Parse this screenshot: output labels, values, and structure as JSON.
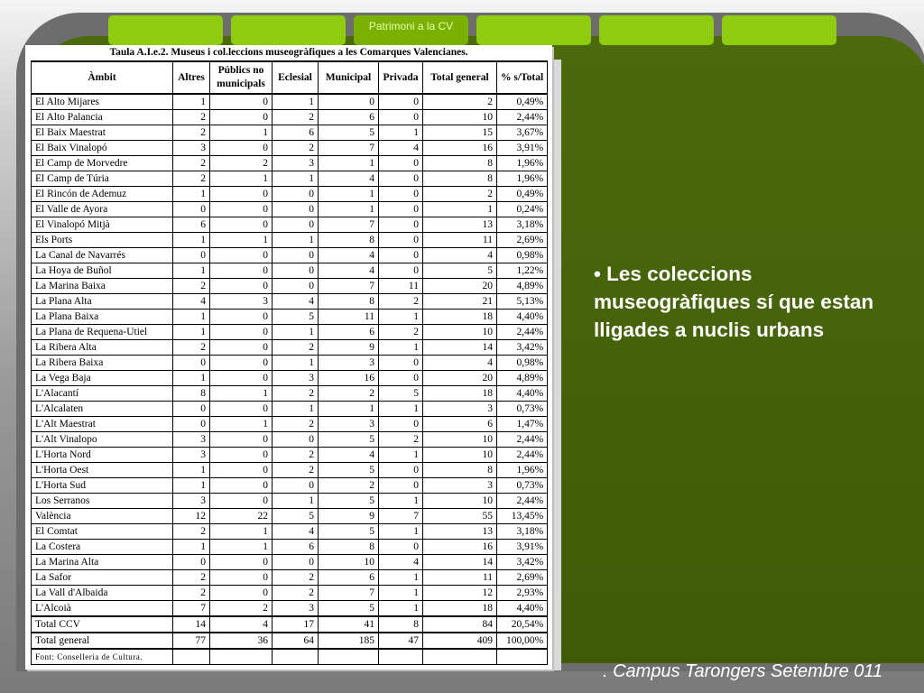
{
  "tabs": [
    {
      "label": ""
    },
    {
      "label": ""
    },
    {
      "label": "Patrimoni a la CV"
    },
    {
      "label": ""
    },
    {
      "label": ""
    },
    {
      "label": ""
    }
  ],
  "table": {
    "title": "Taula A.I.e.2. Museus i col.leccions museogràfiques a les Comarques Valencianes.",
    "headers": [
      "Àmbit",
      "Altres",
      "Públics no municipals",
      "Eclesial",
      "Municipal",
      "Privada",
      "Total general",
      "% s/Total"
    ],
    "rows": [
      [
        "El Alto Mijares",
        "1",
        "0",
        "1",
        "0",
        "0",
        "2",
        "0,49%"
      ],
      [
        "El Alto Palancia",
        "2",
        "0",
        "2",
        "6",
        "0",
        "10",
        "2,44%"
      ],
      [
        "El Baix Maestrat",
        "2",
        "1",
        "6",
        "5",
        "1",
        "15",
        "3,67%"
      ],
      [
        "El Baix Vinalopó",
        "3",
        "0",
        "2",
        "7",
        "4",
        "16",
        "3,91%"
      ],
      [
        "El Camp de Morvedre",
        "2",
        "2",
        "3",
        "1",
        "0",
        "8",
        "1,96%"
      ],
      [
        "El Camp de Túria",
        "2",
        "1",
        "1",
        "4",
        "0",
        "8",
        "1,96%"
      ],
      [
        "El Rincón de Ademuz",
        "1",
        "0",
        "0",
        "1",
        "0",
        "2",
        "0,49%"
      ],
      [
        "El Valle de Ayora",
        "0",
        "0",
        "0",
        "1",
        "0",
        "1",
        "0,24%"
      ],
      [
        "El Vinalopó Mitjà",
        "6",
        "0",
        "0",
        "7",
        "0",
        "13",
        "3,18%"
      ],
      [
        "Els Ports",
        "1",
        "1",
        "1",
        "8",
        "0",
        "11",
        "2,69%"
      ],
      [
        "La Canal de Navarrés",
        "0",
        "0",
        "0",
        "4",
        "0",
        "4",
        "0,98%"
      ],
      [
        "La Hoya de Buñol",
        "1",
        "0",
        "0",
        "4",
        "0",
        "5",
        "1,22%"
      ],
      [
        "La Marina Baixa",
        "2",
        "0",
        "0",
        "7",
        "11",
        "20",
        "4,89%"
      ],
      [
        "La Plana Alta",
        "4",
        "3",
        "4",
        "8",
        "2",
        "21",
        "5,13%"
      ],
      [
        "La Plana Baixa",
        "1",
        "0",
        "5",
        "11",
        "1",
        "18",
        "4,40%"
      ],
      [
        "La Plana de Requena-Utiel",
        "1",
        "0",
        "1",
        "6",
        "2",
        "10",
        "2,44%"
      ],
      [
        "La Ribera Alta",
        "2",
        "0",
        "2",
        "9",
        "1",
        "14",
        "3,42%"
      ],
      [
        "La Ribera Baixa",
        "0",
        "0",
        "1",
        "3",
        "0",
        "4",
        "0,98%"
      ],
      [
        "La Vega Baja",
        "1",
        "0",
        "3",
        "16",
        "0",
        "20",
        "4,89%"
      ],
      [
        "L'Alacantí",
        "8",
        "1",
        "2",
        "2",
        "5",
        "18",
        "4,40%"
      ],
      [
        "L'Alcalaten",
        "0",
        "0",
        "1",
        "1",
        "1",
        "3",
        "0,73%"
      ],
      [
        "L'Alt Maestrat",
        "0",
        "1",
        "2",
        "3",
        "0",
        "6",
        "1,47%"
      ],
      [
        "L'Alt Vinalopo",
        "3",
        "0",
        "0",
        "5",
        "2",
        "10",
        "2,44%"
      ],
      [
        "L'Horta Nord",
        "3",
        "0",
        "2",
        "4",
        "1",
        "10",
        "2,44%"
      ],
      [
        "L'Horta Oest",
        "1",
        "0",
        "2",
        "5",
        "0",
        "8",
        "1,96%"
      ],
      [
        "L'Horta Sud",
        "1",
        "0",
        "0",
        "2",
        "0",
        "3",
        "0,73%"
      ],
      [
        "Los Serranos",
        "3",
        "0",
        "1",
        "5",
        "1",
        "10",
        "2,44%"
      ],
      [
        "València",
        "12",
        "22",
        "5",
        "9",
        "7",
        "55",
        "13,45%"
      ],
      [
        "El Comtat",
        "2",
        "1",
        "4",
        "5",
        "1",
        "13",
        "3,18%"
      ],
      [
        "La Costera",
        "1",
        "1",
        "6",
        "8",
        "0",
        "16",
        "3,91%"
      ],
      [
        "La Marina Alta",
        "0",
        "0",
        "0",
        "10",
        "4",
        "14",
        "3,42%"
      ],
      [
        "La Safor",
        "2",
        "0",
        "2",
        "6",
        "1",
        "11",
        "2,69%"
      ],
      [
        "La Vall d'Albaida",
        "2",
        "0",
        "2",
        "7",
        "1",
        "12",
        "2,93%"
      ],
      [
        "L'Alcoià",
        "7",
        "2",
        "3",
        "5",
        "1",
        "18",
        "4,40%"
      ]
    ],
    "total_ccv": [
      "Total CCV",
      "14",
      "4",
      "17",
      "41",
      "8",
      "84",
      "20,54%"
    ],
    "total_general": [
      "Total general",
      "77",
      "36",
      "64",
      "185",
      "47",
      "409",
      "100,00%"
    ],
    "source": "Font: Conselleria de Cultura."
  },
  "bullet": "• Les coleccions museogràfiques sí que estan lligades a nuclis urbans",
  "footer": ". Campus Tarongers Setembre 011"
}
